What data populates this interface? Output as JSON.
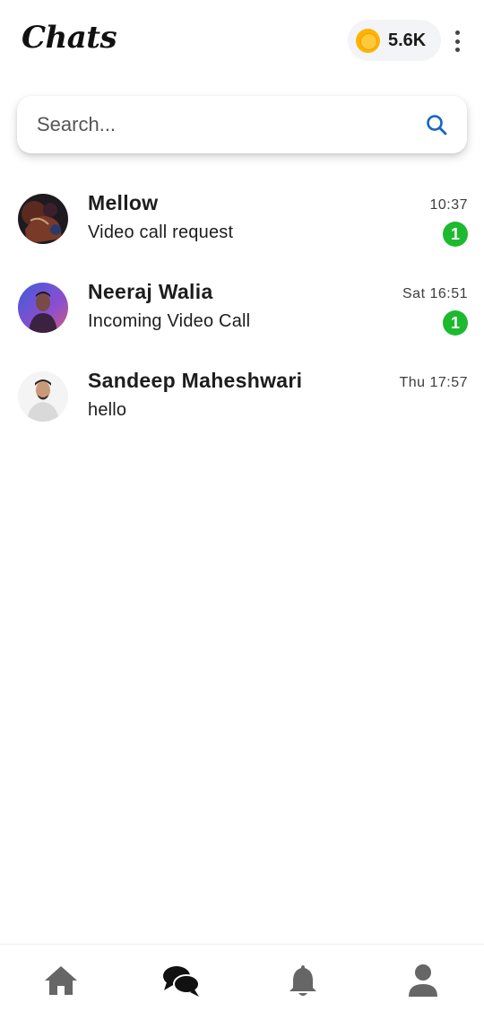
{
  "header": {
    "title": "Chats",
    "coin_count": "5.6K",
    "icons": {
      "coin": "coin-icon",
      "more": "more-vert-icon"
    }
  },
  "search": {
    "placeholder": "Search...",
    "value": "",
    "icon": "search-icon",
    "icon_color": "#1565c0"
  },
  "chats": [
    {
      "name": "Mellow",
      "message": "Video call request",
      "time": "10:37",
      "unread": "1"
    },
    {
      "name": "Neeraj Walia",
      "message": "Incoming Video Call",
      "time": "Sat 16:51",
      "unread": "1"
    },
    {
      "name": "Sandeep Maheshwari",
      "message": "hello",
      "time": "Thu 17:57",
      "unread": ""
    }
  ],
  "bottom_nav": {
    "items": [
      {
        "icon": "home-icon",
        "active": false
      },
      {
        "icon": "chat-bubbles-icon",
        "active": true
      },
      {
        "icon": "bell-icon",
        "active": false
      },
      {
        "icon": "person-icon",
        "active": false
      }
    ]
  },
  "colors": {
    "unread_badge": "#1db92f",
    "coin": "#ffb300",
    "nav_active": "#111111",
    "nav_inactive": "#666666"
  }
}
